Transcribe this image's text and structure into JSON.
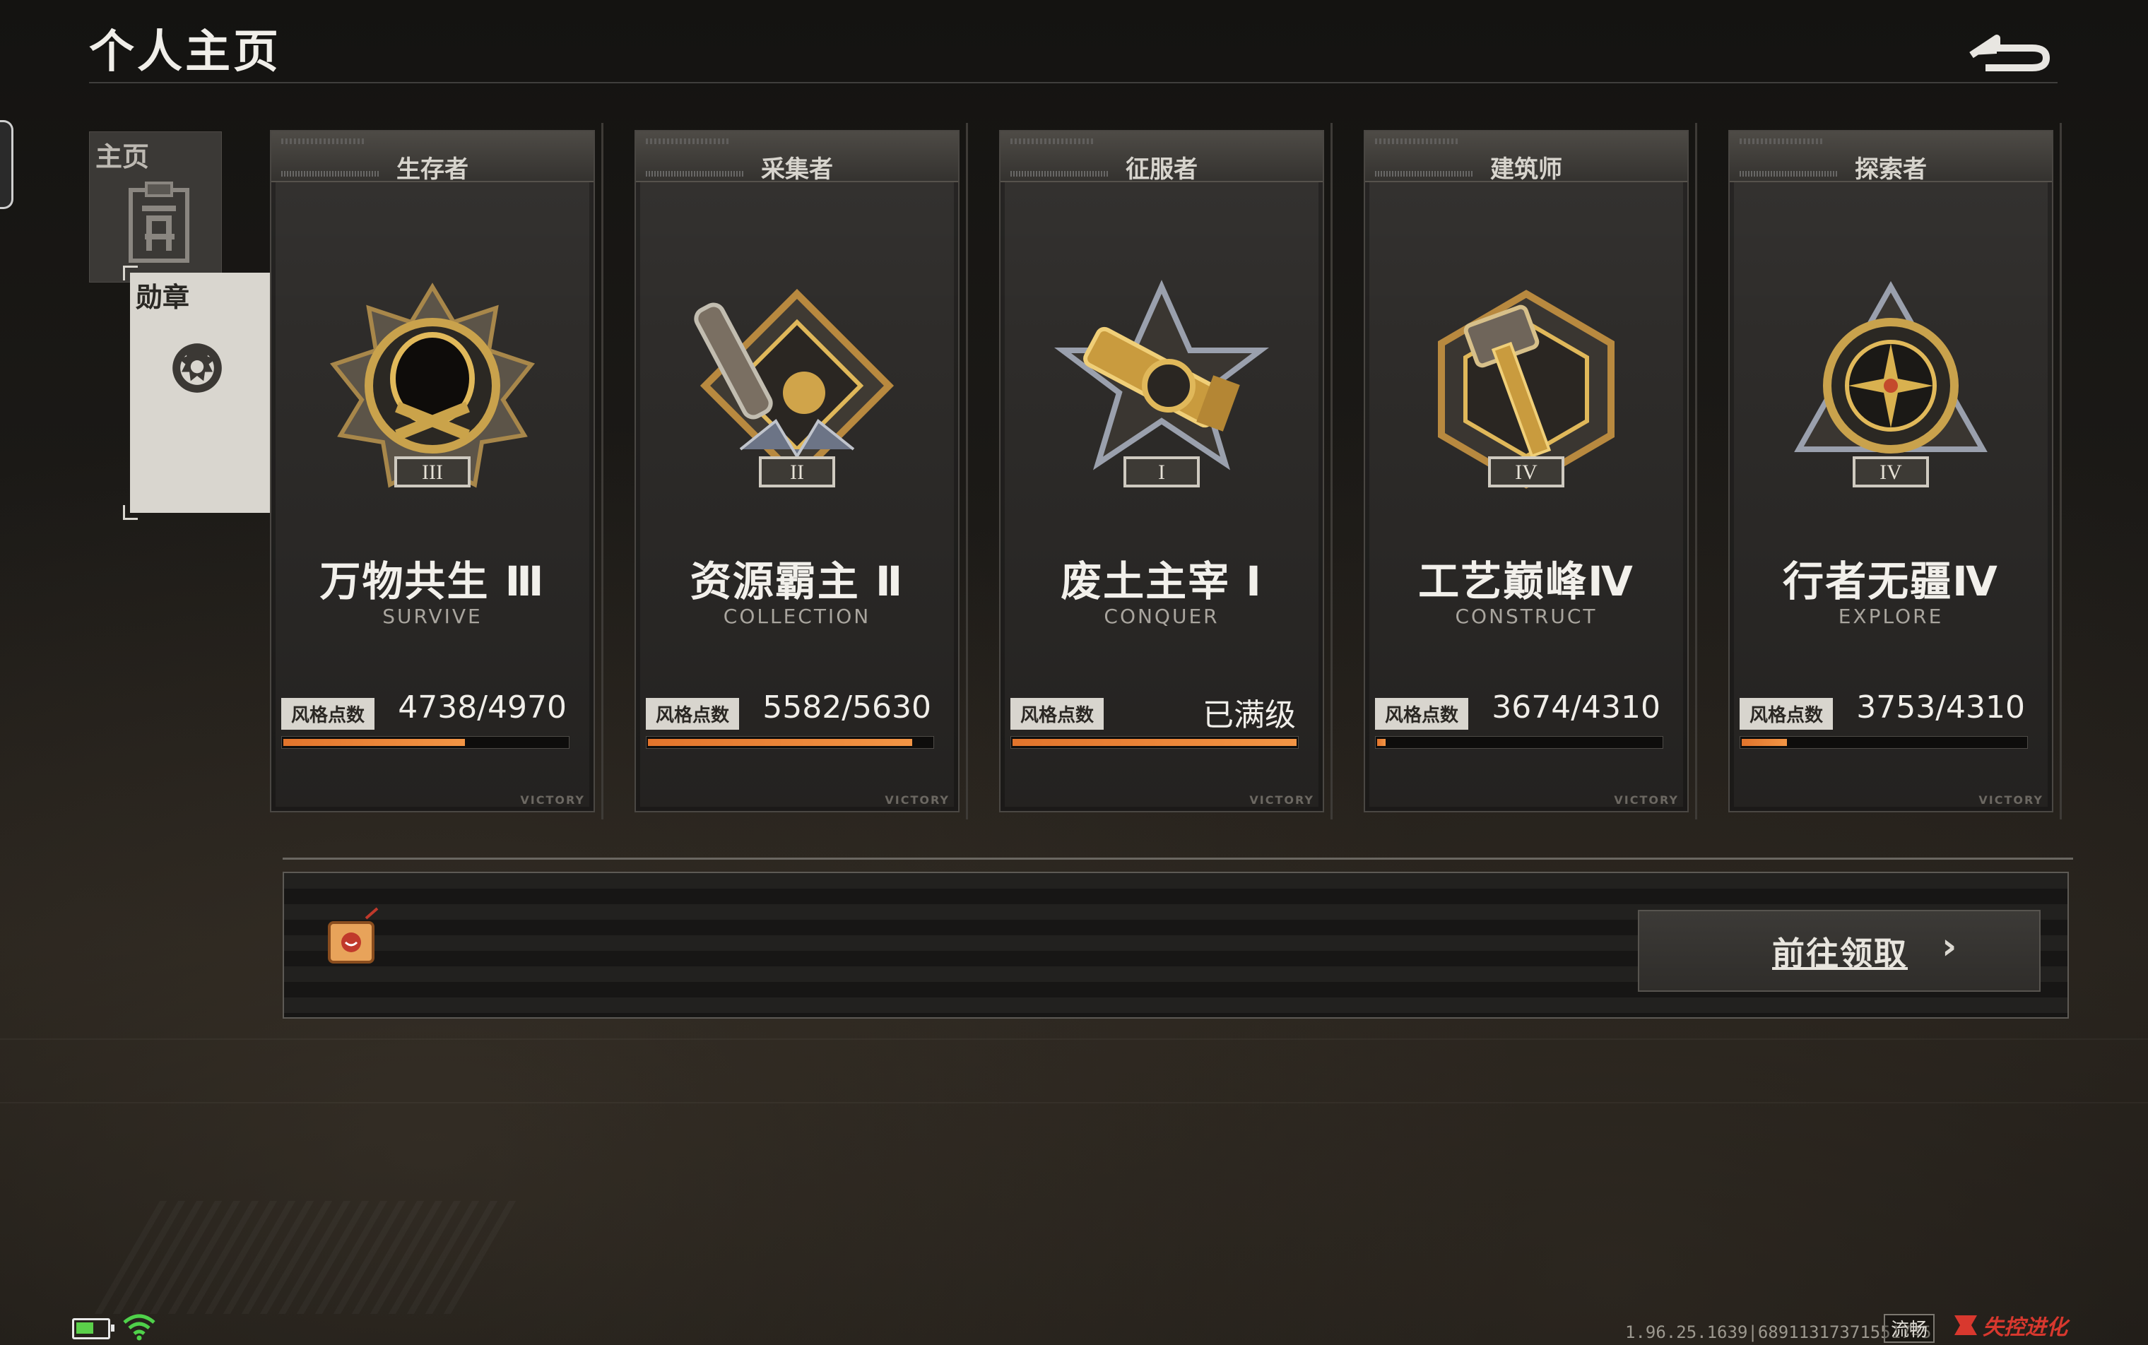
{
  "header": {
    "title": "个人主页"
  },
  "side_nav": [
    {
      "label": "主页",
      "active": false
    },
    {
      "label": "勋章",
      "active": true
    }
  ],
  "cards": [
    {
      "role": "生存者",
      "name": "万物共生 Ⅲ",
      "subtitle": "SURVIVE",
      "points_label": "风格点数",
      "points_value": "4738/4970",
      "progress": 0.64,
      "footer": "VICTORY"
    },
    {
      "role": "采集者",
      "name": "资源霸主 Ⅱ",
      "subtitle": "COLLECTION",
      "points_label": "风格点数",
      "points_value": "5582/5630",
      "progress": 0.93,
      "footer": "VICTORY"
    },
    {
      "role": "征服者",
      "name": "废土主宰 Ⅰ",
      "subtitle": "CONQUER",
      "points_label": "风格点数",
      "points_value": "已满级",
      "progress": 1.0,
      "footer": "VICTORY"
    },
    {
      "role": "建筑师",
      "name": "工艺巅峰Ⅳ",
      "subtitle": "CONSTRUCT",
      "points_label": "风格点数",
      "points_value": "3674/4310",
      "progress": 0.03,
      "footer": "VICTORY"
    },
    {
      "role": "探索者",
      "name": "行者无疆Ⅳ",
      "subtitle": "EXPLORE",
      "points_label": "风格点数",
      "points_value": "3753/4310",
      "progress": 0.16,
      "footer": "VICTORY"
    }
  ],
  "reward_panel": {
    "button_label": "前往领取",
    "button_arrow": "›"
  },
  "status_bar": {
    "version": "1.96.25.1639|68911317371551745",
    "fluency": "流畅",
    "game_name": "失控进化"
  },
  "colors": {
    "accent": "#f08a3c",
    "background": "#1a1815",
    "logo_red": "#d8382e"
  },
  "icons": [
    "back-icon",
    "home-icon",
    "medal-icon",
    "gift-tv-icon",
    "battery-icon",
    "wifi-icon",
    "game-logo-icon"
  ]
}
